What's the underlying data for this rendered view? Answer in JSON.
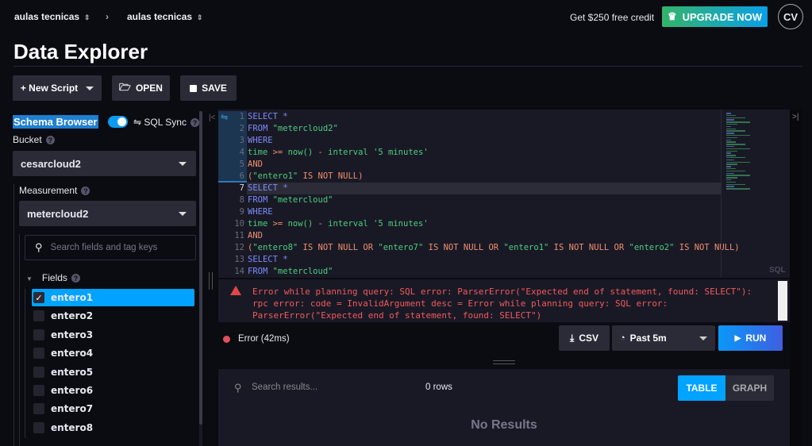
{
  "header": {
    "org": "aulas tecnicas",
    "bucket": "aulas tecnicas",
    "credit": "Get $250 free credit",
    "upgrade": "UPGRADE NOW",
    "avatar": "CV",
    "title": "Data Explorer"
  },
  "toolbar": {
    "new_script": "+ New Script",
    "open": "OPEN",
    "save": "SAVE"
  },
  "schema": {
    "title": "Schema Browser",
    "sql_sync": "⇋ SQL Sync",
    "sync_on": true,
    "bucket_label": "Bucket",
    "bucket": "cesarcloud2",
    "measurement_label": "Measurement",
    "measurement": "metercloud2",
    "search_placeholder": "Search fields and tag keys",
    "fields_label": "Fields",
    "fields": [
      {
        "name": "entero1",
        "checked": true
      },
      {
        "name": "entero2",
        "checked": false
      },
      {
        "name": "entero3",
        "checked": false
      },
      {
        "name": "entero4",
        "checked": false
      },
      {
        "name": "entero5",
        "checked": false
      },
      {
        "name": "entero6",
        "checked": false
      },
      {
        "name": "entero7",
        "checked": false
      },
      {
        "name": "entero8",
        "checked": false
      }
    ]
  },
  "editor": {
    "language": "SQL",
    "current_line": 7,
    "lines": [
      [
        [
          "SELECT *",
          "kw"
        ]
      ],
      [
        [
          "FROM ",
          "kw"
        ],
        [
          "\"metercloud2\"",
          "str"
        ]
      ],
      [
        [
          "WHERE",
          "kw"
        ]
      ],
      [
        [
          "time ",
          "fn"
        ],
        [
          ">=",
          "op"
        ],
        [
          " now() ",
          "fn"
        ],
        [
          "-",
          "op"
        ],
        [
          " interval '5 minutes'",
          "str"
        ]
      ],
      [
        [
          "AND",
          "op"
        ]
      ],
      [
        [
          "(",
          "op"
        ],
        [
          "\"entero1\"",
          "str"
        ],
        [
          " IS NOT NULL)",
          "op"
        ]
      ],
      [
        [
          "SELECT *",
          "kw"
        ]
      ],
      [
        [
          "FROM ",
          "kw"
        ],
        [
          "\"metercloud\"",
          "str"
        ]
      ],
      [
        [
          "WHERE",
          "kw"
        ]
      ],
      [
        [
          "time ",
          "fn"
        ],
        [
          ">=",
          "op"
        ],
        [
          " now() ",
          "fn"
        ],
        [
          "-",
          "op"
        ],
        [
          " interval '5 minutes'",
          "str"
        ]
      ],
      [
        [
          "AND",
          "op"
        ]
      ],
      [
        [
          "(",
          "op"
        ],
        [
          "\"entero8\"",
          "str"
        ],
        [
          " IS NOT NULL OR ",
          "op"
        ],
        [
          "\"entero7\"",
          "str"
        ],
        [
          " IS NOT NULL OR ",
          "op"
        ],
        [
          "\"entero1\"",
          "str"
        ],
        [
          " IS NOT NULL OR ",
          "op"
        ],
        [
          "\"entero2\"",
          "str"
        ],
        [
          " IS NOT NULL)",
          "op"
        ]
      ],
      [
        [
          "SELECT *",
          "kw"
        ]
      ],
      [
        [
          "FROM ",
          "kw"
        ],
        [
          "\"metercloud\"",
          "str"
        ]
      ]
    ]
  },
  "error": {
    "message": "Error while planning query: SQL error: ParserError(\"Expected end of statement, found: SELECT\"): rpc error: code = InvalidArgument desc = Error while planning query: SQL error: ParserError(\"Expected end of statement, found: SELECT\")"
  },
  "status": {
    "text": "Error (42ms)",
    "color": "#e0505a",
    "csv": "CSV",
    "time_range": "Past 5m",
    "run": "RUN"
  },
  "results": {
    "search_placeholder": "Search results...",
    "rows": "0 rows",
    "table": "TABLE",
    "graph": "GRAPH",
    "empty": "No Results"
  }
}
